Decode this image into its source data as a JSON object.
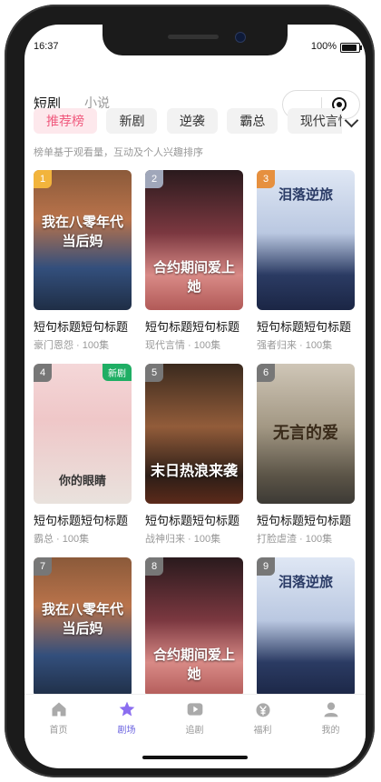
{
  "status": {
    "time": "16:37",
    "battery": "100%"
  },
  "header": {
    "tab_active": "短剧",
    "tab_inactive": "小说"
  },
  "chips": [
    "推荐榜",
    "新剧",
    "逆袭",
    "霸总",
    "现代言情"
  ],
  "hint": "榜单基于观看量，互动及个人兴趣排序",
  "cards": [
    {
      "rank": "1",
      "poster_text": "我在八零年代当后妈",
      "title": "短句标题短句标题",
      "meta": "豪门恩怨 · 100集",
      "badge": ""
    },
    {
      "rank": "2",
      "poster_text": "合约期间爱上她",
      "title": "短句标题短句标题",
      "meta": "现代言情 · 100集",
      "badge": ""
    },
    {
      "rank": "3",
      "poster_text": "泪落逆旅",
      "title": "短句标题短句标题",
      "meta": "强者归来 · 100集",
      "badge": ""
    },
    {
      "rank": "4",
      "poster_text": "你的眼睛",
      "title": "短句标题短句标题",
      "meta": "霸总 · 100集",
      "badge": "新剧"
    },
    {
      "rank": "5",
      "poster_text": "末日热浪来袭",
      "title": "短句标题短句标题",
      "meta": "战神归来 · 100集",
      "badge": ""
    },
    {
      "rank": "6",
      "poster_text": "无言的爱",
      "title": "短句标题短句标题",
      "meta": "打脸虐渣 · 100集",
      "badge": ""
    },
    {
      "rank": "7",
      "poster_text": "我在八零年代当后妈",
      "title": "",
      "meta": "",
      "badge": ""
    },
    {
      "rank": "8",
      "poster_text": "合约期间爱上她",
      "title": "",
      "meta": "",
      "badge": ""
    },
    {
      "rank": "9",
      "poster_text": "泪落逆旅",
      "title": "",
      "meta": "",
      "badge": ""
    }
  ],
  "tabbar": [
    {
      "label": "首页",
      "icon": "home-icon"
    },
    {
      "label": "剧场",
      "icon": "star-icon"
    },
    {
      "label": "追剧",
      "icon": "play-icon"
    },
    {
      "label": "福利",
      "icon": "gift-icon"
    },
    {
      "label": "我的",
      "icon": "user-icon"
    }
  ]
}
